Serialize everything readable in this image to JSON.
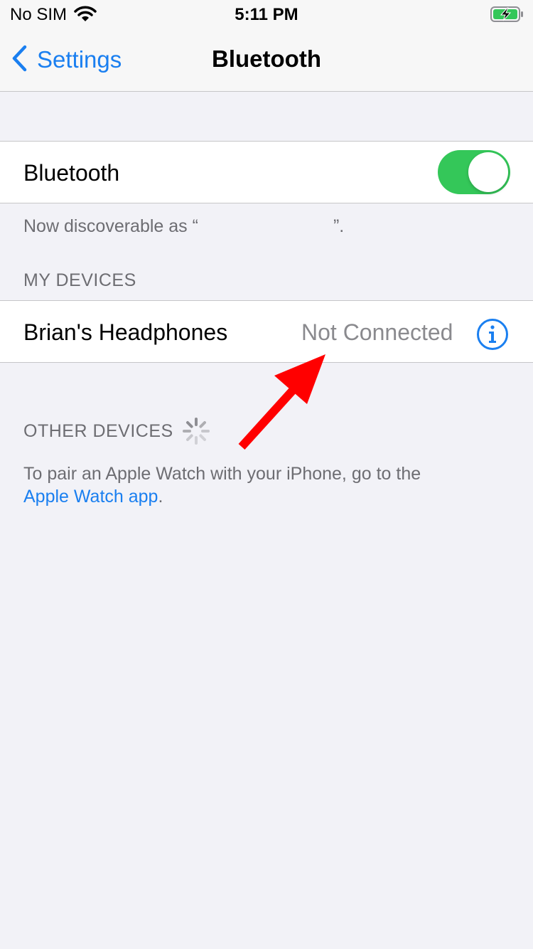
{
  "status_bar": {
    "carrier": "No SIM",
    "time": "5:11 PM",
    "wifi_icon": "wifi-icon",
    "battery_icon": "battery-charging-icon"
  },
  "nav": {
    "back_label": "Settings",
    "title": "Bluetooth"
  },
  "bluetooth": {
    "label": "Bluetooth",
    "enabled": true,
    "toggle_color": "#34c759",
    "discoverable_prefix": "Now discoverable as “",
    "discoverable_suffix": "”."
  },
  "my_devices": {
    "header": "MY DEVICES",
    "items": [
      {
        "name": "Brian's Headphones",
        "status": "Not Connected"
      }
    ]
  },
  "other_devices": {
    "header": "OTHER DEVICES",
    "pair_text": "To pair an Apple Watch with your iPhone, go to the",
    "pair_link": "Apple Watch app",
    "pair_suffix": "."
  },
  "colors": {
    "accent": "#1a7ff0",
    "background": "#f2f2f7",
    "annotation_arrow": "#ff0000"
  }
}
